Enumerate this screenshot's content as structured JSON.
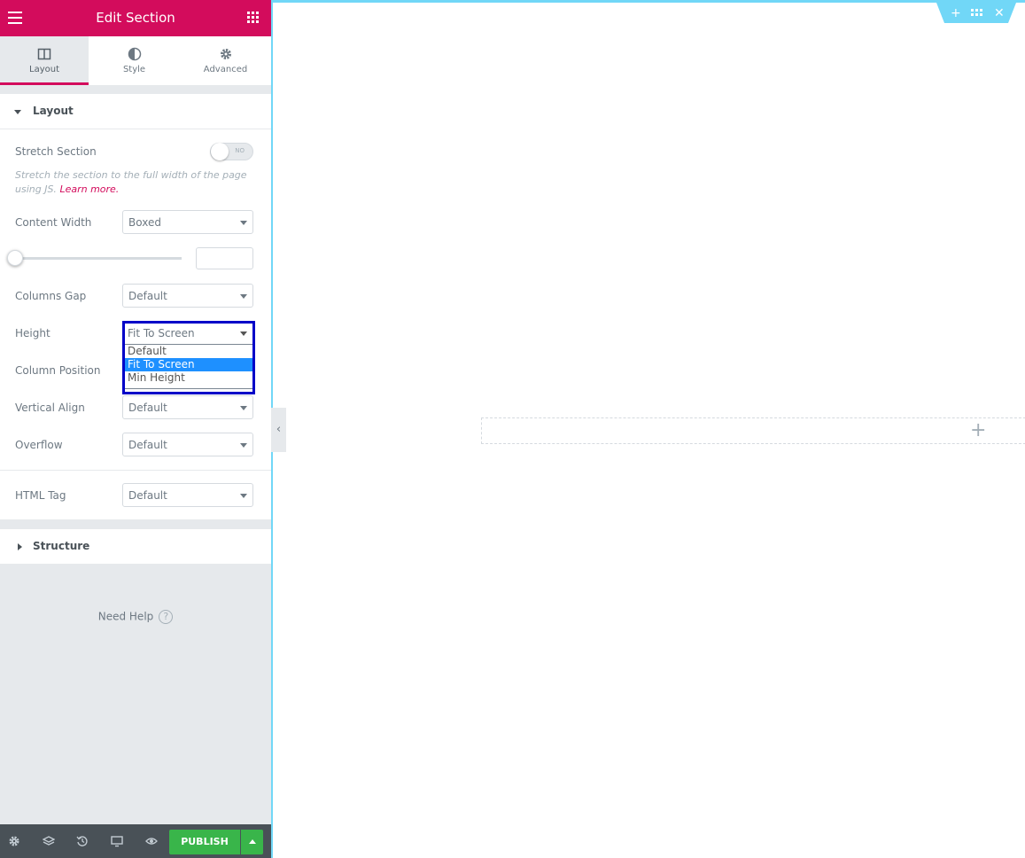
{
  "header": {
    "title": "Edit Section"
  },
  "tabs": [
    {
      "label": "Layout",
      "active": true
    },
    {
      "label": "Style",
      "active": false
    },
    {
      "label": "Advanced",
      "active": false
    }
  ],
  "layout_section": {
    "title": "Layout",
    "stretch": {
      "label": "Stretch Section",
      "toggle_text": "NO",
      "desc_prefix": "Stretch the section to the full width of the page using JS.",
      "desc_link": "Learn more."
    },
    "content_width": {
      "label": "Content Width",
      "value": "Boxed"
    },
    "columns_gap": {
      "label": "Columns Gap",
      "value": "Default"
    },
    "height": {
      "label": "Height",
      "value": "Fit To Screen",
      "options": [
        "Default",
        "Fit To Screen",
        "Min Height"
      ],
      "selected_option": "Fit To Screen"
    },
    "column_position": {
      "label": "Column Position"
    },
    "vertical_align": {
      "label": "Vertical Align",
      "value": "Default"
    },
    "overflow": {
      "label": "Overflow",
      "value": "Default"
    },
    "html_tag": {
      "label": "HTML Tag",
      "value": "Default"
    }
  },
  "structure_section": {
    "title": "Structure"
  },
  "help": {
    "label": "Need Help",
    "icon": "?"
  },
  "footer": {
    "publish_label": "PUBLISH"
  },
  "colors": {
    "brand": "#d30c5c",
    "publish": "#39b54a",
    "canvas_accent": "#71d7f7"
  }
}
